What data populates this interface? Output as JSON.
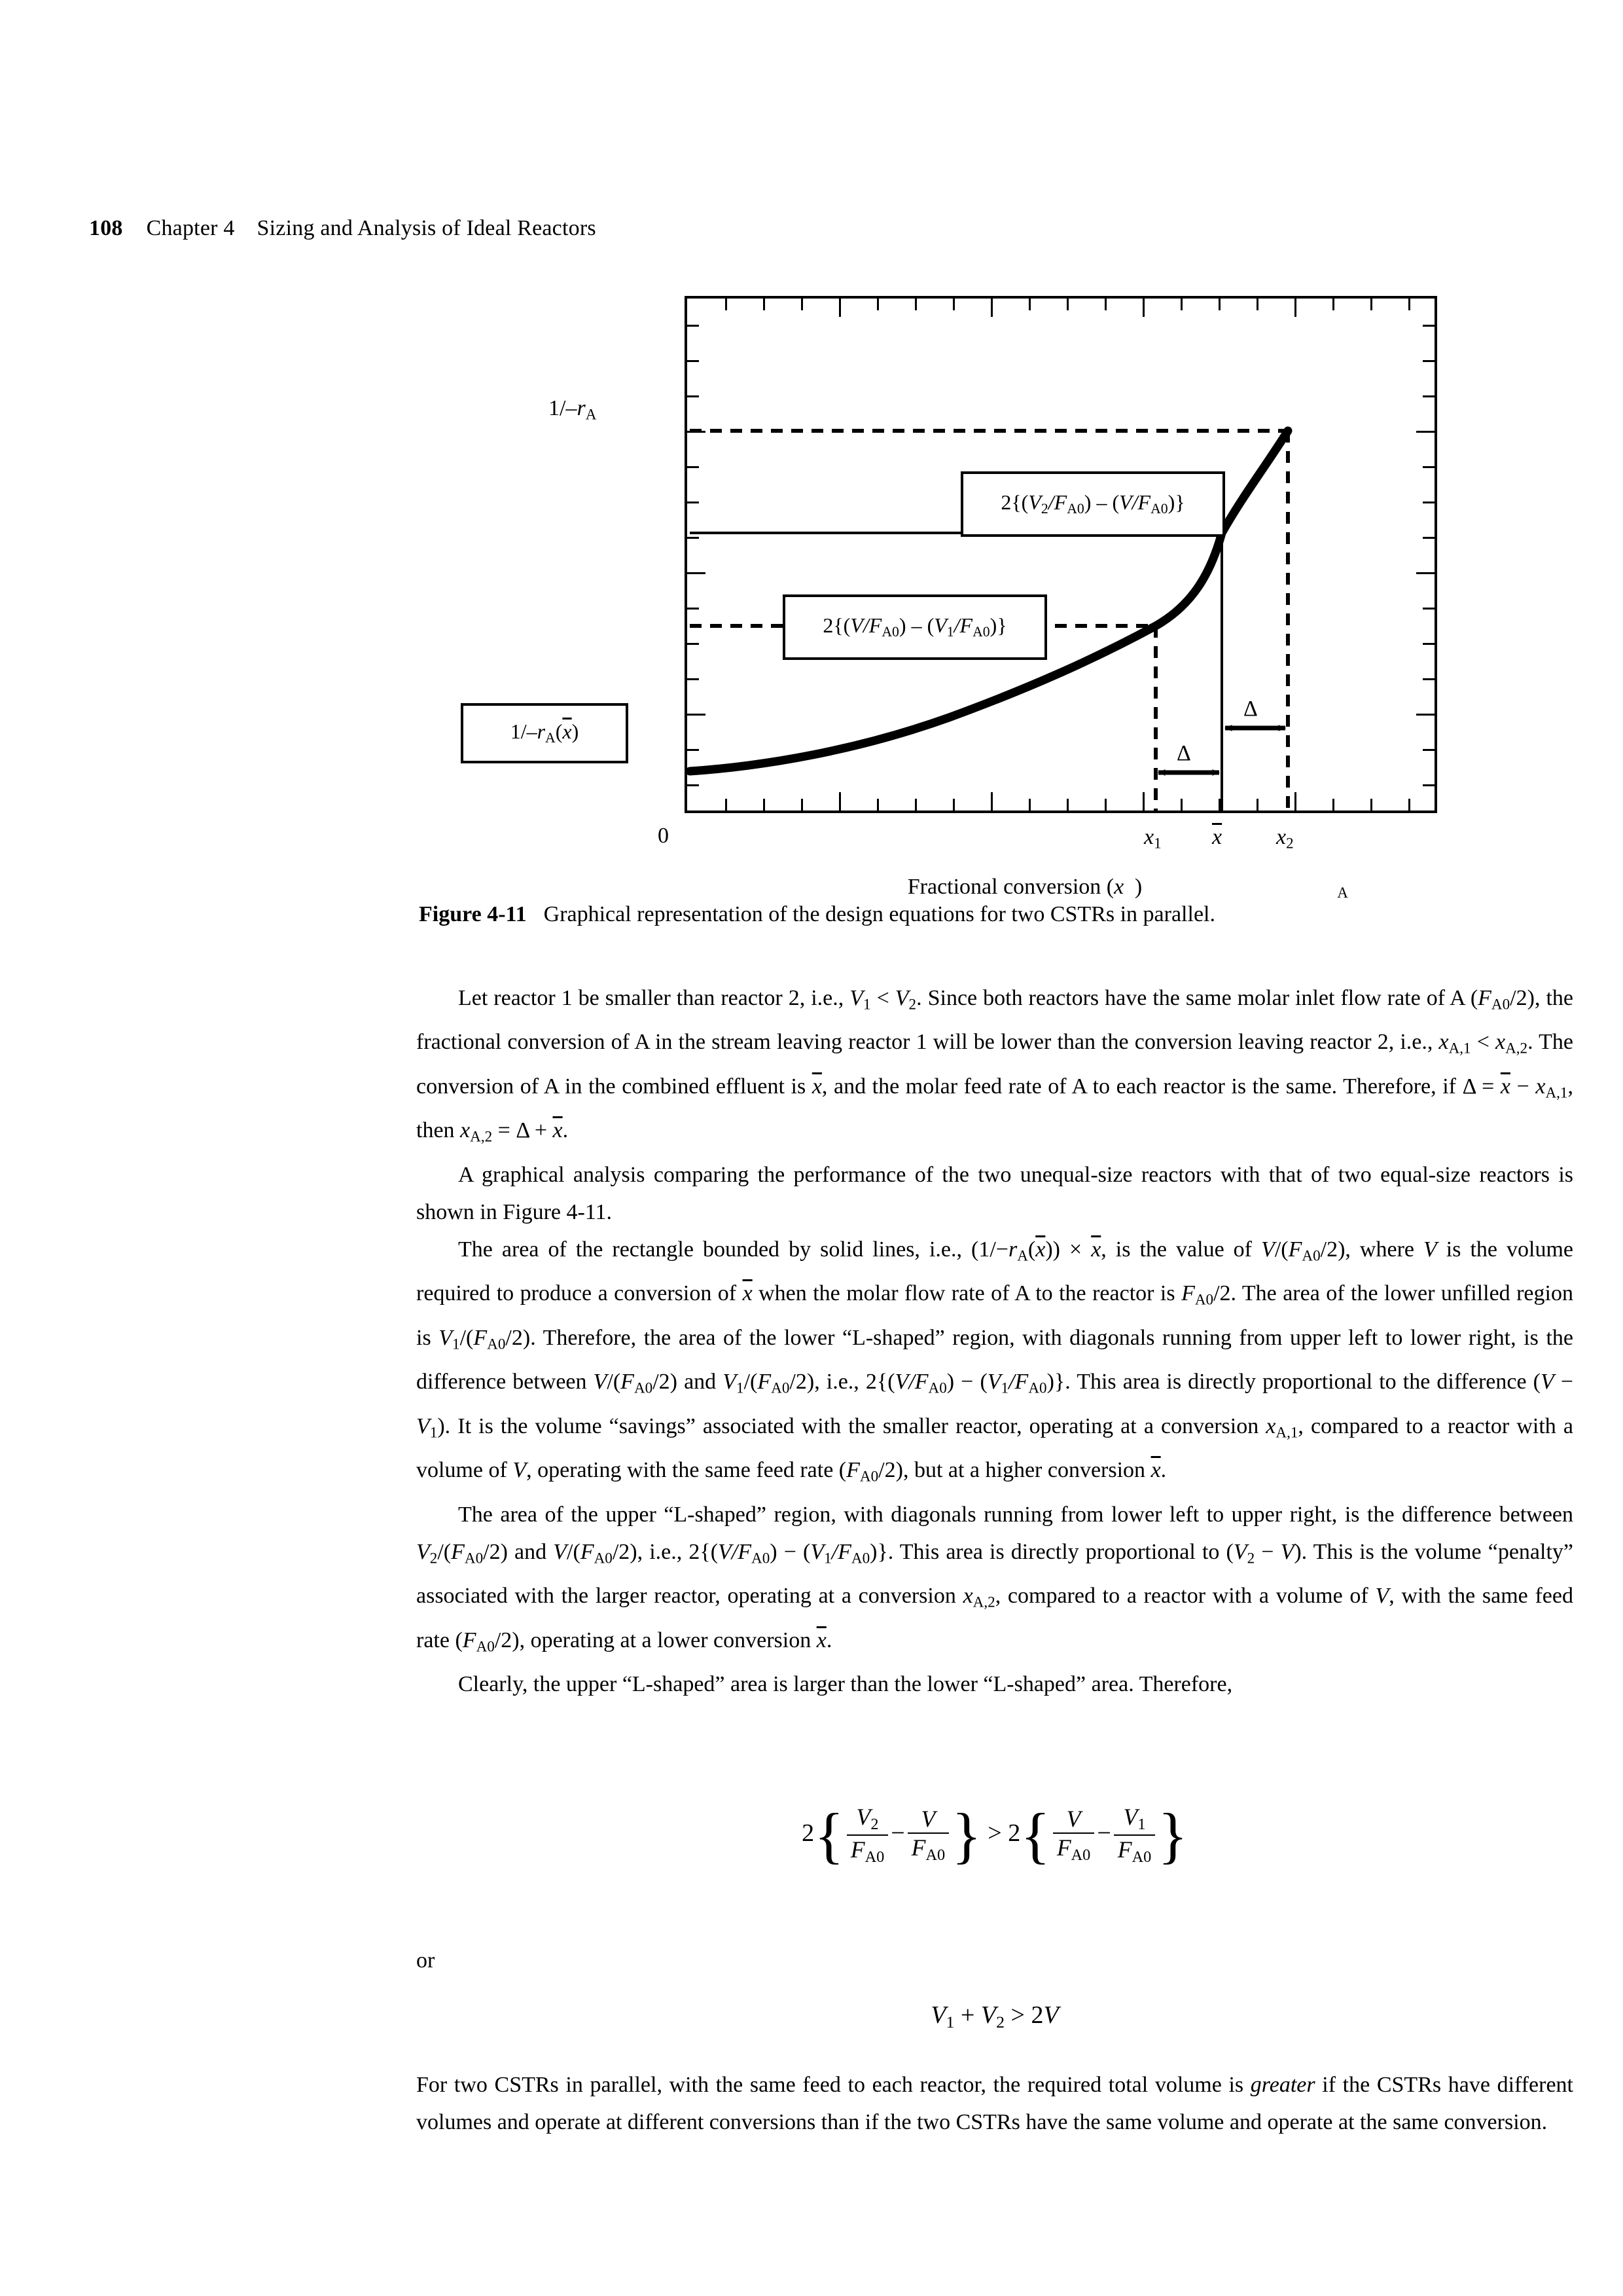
{
  "running_head": {
    "page_number": "108",
    "chapter": "Chapter 4",
    "title": "Sizing and Analysis of Ideal Reactors"
  },
  "figure": {
    "y_axis_label": "1/-rA",
    "x_axis_label": "Fractional conversion (xA)",
    "origin_label": "0",
    "x_tick_labels": [
      "x1",
      "x̄",
      "x2"
    ],
    "callout_upper": "2{(V2/FA0) − (V/FA0)}",
    "callout_lower": "2{(V/FA0) − (V1/FA0)}",
    "callout_y_value": "1/-rA(x̄)",
    "delta_label_lower": "Δ",
    "delta_label_upper": "Δ",
    "caption_label": "Figure 4-11",
    "caption_text": "Graphical representation of the design equations for two CSTRs in parallel."
  },
  "chart_data": {
    "type": "line",
    "title": "Graphical representation of the design equations for two CSTRs in parallel.",
    "xlabel": "Fractional conversion (xA)",
    "ylabel": "1/-rA",
    "grid": false,
    "legend": null,
    "xlim": [
      0,
      1
    ],
    "ylim": [
      0,
      1
    ],
    "x_ticks_labeled": [
      {
        "label": "x1",
        "x": 0.7
      },
      {
        "label": "x̄",
        "x": 0.8
      },
      {
        "label": "x2",
        "x": 0.9
      }
    ],
    "series": [
      {
        "name": "1/-rA vs xA",
        "style": "solid-thick",
        "x": [
          0.0,
          0.1,
          0.2,
          0.3,
          0.4,
          0.5,
          0.6,
          0.7,
          0.75,
          0.8,
          0.85,
          0.9
        ],
        "y": [
          0.08,
          0.098,
          0.12,
          0.148,
          0.185,
          0.235,
          0.305,
          0.405,
          0.475,
          0.57,
          0.71,
          0.915
        ]
      }
    ],
    "annotations": [
      {
        "type": "solid-rectangle",
        "x0": 0.0,
        "x1": 0.8,
        "y0": 0.0,
        "y1": 0.57,
        "note": "rectangle bounded by solid lines = (1/-rA(x̄)) x x̄ = V/(FA0/2)"
      },
      {
        "type": "dashed-horizontal",
        "y": 0.915,
        "x0": 0.0,
        "x1": 0.9,
        "note": "level of 1/-rA at x2"
      },
      {
        "type": "dashed-horizontal",
        "y": 0.405,
        "x0": 0.0,
        "x1": 0.7,
        "note": "level of 1/-rA at x1"
      },
      {
        "type": "dashed-vertical",
        "x": 0.7,
        "y0": 0.0,
        "y1": 0.405
      },
      {
        "type": "dashed-vertical",
        "x": 0.9,
        "y0": 0.0,
        "y1": 0.915
      },
      {
        "type": "double-arrow",
        "label": "Δ",
        "x0": 0.7,
        "x1": 0.8,
        "y": 0.075
      },
      {
        "type": "double-arrow",
        "label": "Δ",
        "x0": 0.8,
        "x1": 0.9,
        "y": 0.175
      },
      {
        "type": "callout-box",
        "text": "2{(V2/FA0) − (V/FA0)}",
        "region": "upper L-shaped"
      },
      {
        "type": "callout-box",
        "text": "2{(V/FA0) − (V1/FA0)}",
        "region": "lower L-shaped"
      },
      {
        "type": "callout-box-with-arrow",
        "text": "1/-rA(x̄)",
        "points_to": "y-axis at 1/-rA(x̄)"
      }
    ]
  },
  "body": {
    "p1_a": "Let reactor 1 be smaller than reactor 2, i.e., ",
    "p1_b": ". Since both reactors have the same molar inlet flow rate of A (",
    "p1_c": "), the fractional conversion of A in the stream leaving reactor 1 will be lower than the conversion leaving reactor 2, i.e., ",
    "p1_d": ". The conversion of A in the combined effluent is ",
    "p1_e": ", and the molar feed rate of A to each reactor is the same. Therefore, if ",
    "p1_f": ", then ",
    "p1_g": ".",
    "p2": "A graphical analysis comparing the performance of the two unequal-size reactors with that of two equal-size reactors is shown in Figure 4-11.",
    "p3_a": "The area of the rectangle bounded by solid lines, i.e., ",
    "p3_b": ", is the value of ",
    "p3_c": ", where ",
    "p3_d": " is the volume required to produce a conversion of ",
    "p3_e": " when the molar flow rate of A to the reactor is ",
    "p3_f": ". The area of the lower unfilled region is ",
    "p3_g": ". Therefore, the area of the lower “L-shaped” region, with diagonals running from upper left to lower right, is the difference between ",
    "p3_h": " and ",
    "p3_i": ", i.e., ",
    "p3_j": ". This area is directly proportional to the difference ",
    "p3_k": ". It is the volume “savings” associated with the smaller reactor, operating at a conversion ",
    "p3_l": ", compared to a reactor with a volume of ",
    "p3_m": ", operating with the same feed rate ",
    "p3_n": ", but at a higher conversion ",
    "p3_o": ".",
    "p4_a": "The area of the upper “L-shaped” region, with diagonals running from lower left to upper right, is the difference between ",
    "p4_b": " and ",
    "p4_c": ", i.e., ",
    "p4_d": ". This area is directly proportional to ",
    "p4_e": ". This is the volume “penalty” associated with the larger reactor, operating at a conversion ",
    "p4_f": ", compared to a reactor with a volume of ",
    "p4_g": ", with the same feed rate ",
    "p4_h": ", operating at a lower conversion ",
    "p4_i": ".",
    "p5": "Clearly, the upper “L-shaped” area is larger than the lower “L-shaped” area. Therefore,",
    "or_word": "or",
    "p6_a": "For two CSTRs in parallel, with the same feed to each reactor, the required total volume is ",
    "p6_italic": "greater",
    "p6_b": " if the CSTRs have different volumes and operate at different conversions than if the two CSTRs have the same volume and operate at the same conversion."
  },
  "equations": {
    "eq1": "2{V2/FA0 − V/FA0} > 2{V/FA0 − V1/FA0}",
    "eq2": "V1 + V2 > 2V"
  }
}
